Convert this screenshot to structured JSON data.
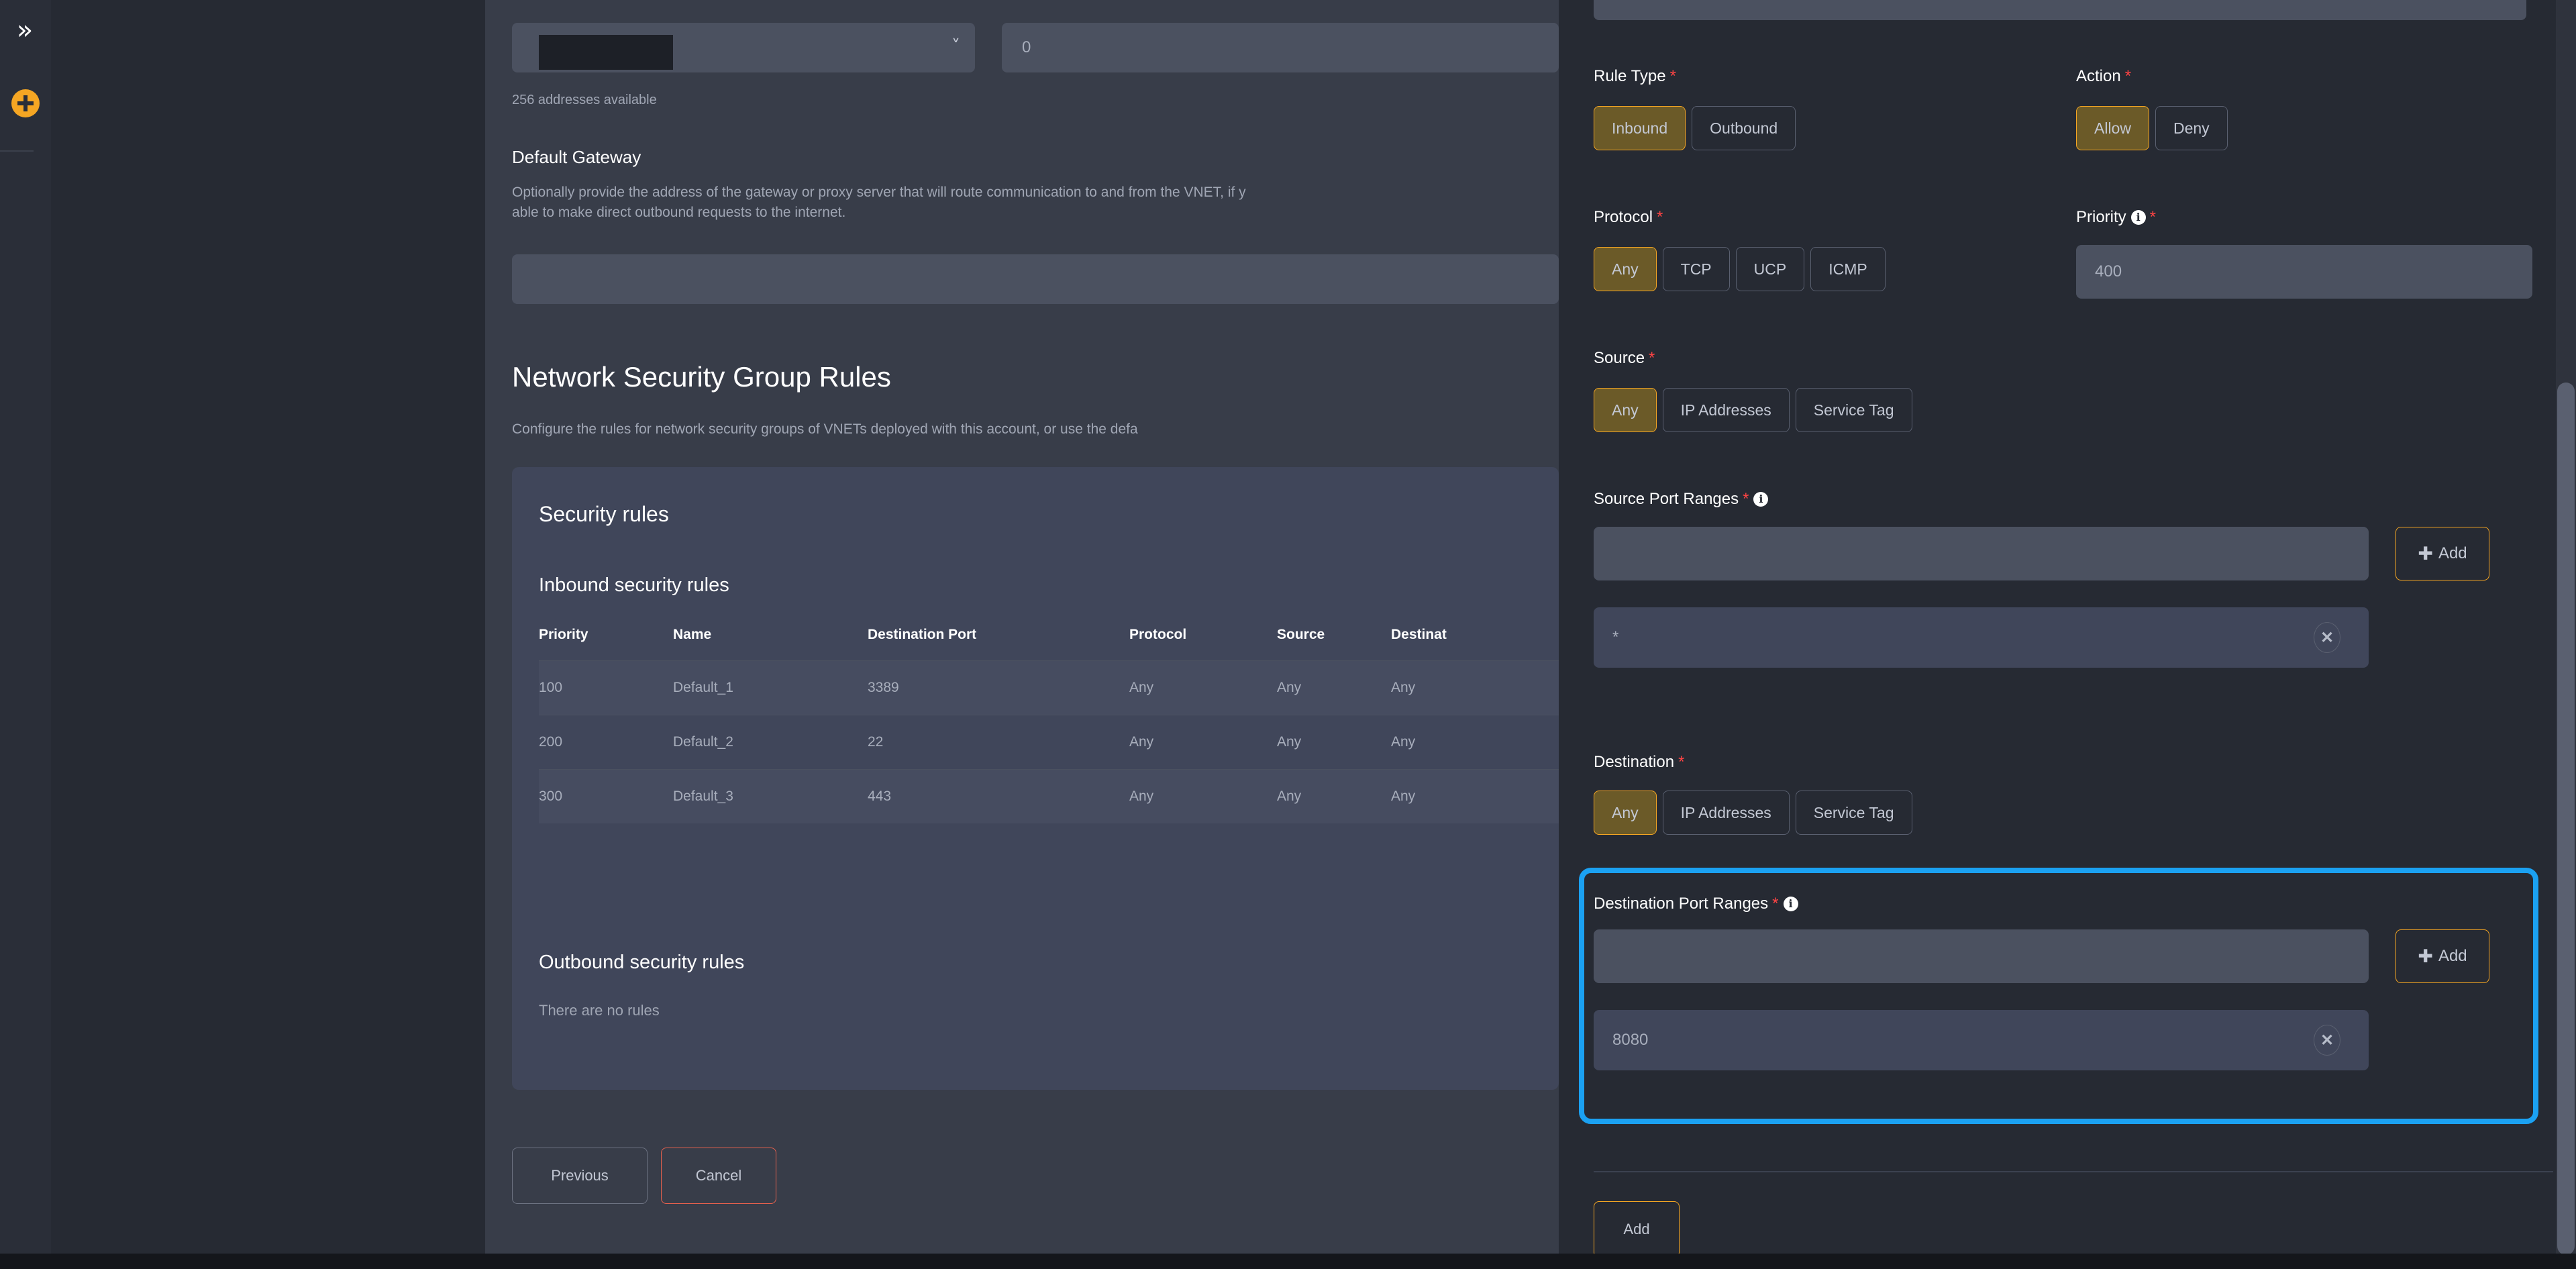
{
  "rail": {
    "collapse_icon": "double-chevron-right-icon",
    "add_icon": "plus-circle-icon"
  },
  "left_panel": {
    "address_space": {
      "helper": "256 addresses available",
      "dropdown_value": "",
      "caret": "▾"
    },
    "max_nodes": {
      "value": "0"
    },
    "default_gateway": {
      "title": "Default Gateway",
      "description": "Optionally provide the address of the gateway or proxy server that will route communication to and from the VNET, if y",
      "description_line2": "able to make direct outbound requests to the internet.",
      "value": ""
    },
    "nsg": {
      "title": "Network Security Group Rules",
      "description": "Configure the rules for network security groups of VNETs deployed with this account, or use the defa"
    },
    "security_rules_card": {
      "title": "Security rules",
      "inbound_title": "Inbound security rules",
      "columns": [
        "Priority",
        "Name",
        "Destination Port",
        "Protocol",
        "Source",
        "Destinat"
      ],
      "rows": [
        {
          "priority": "100",
          "name": "Default_1",
          "destination_port": "3389",
          "protocol": "Any",
          "source": "Any",
          "destination": "Any"
        },
        {
          "priority": "200",
          "name": "Default_2",
          "destination_port": "22",
          "protocol": "Any",
          "source": "Any",
          "destination": "Any"
        },
        {
          "priority": "300",
          "name": "Default_3",
          "destination_port": "443",
          "protocol": "Any",
          "source": "Any",
          "destination": "Any"
        }
      ],
      "outbound_title": "Outbound security rules",
      "outbound_empty": "There are no rules"
    },
    "footer": {
      "previous_label": "Previous",
      "cancel_label": "Cancel"
    }
  },
  "right_panel": {
    "rule_type": {
      "label": "Rule Type",
      "required": "*",
      "options": [
        "Inbound",
        "Outbound"
      ],
      "selected": "Inbound"
    },
    "action": {
      "label": "Action",
      "required": "*",
      "options": [
        "Allow",
        "Deny"
      ],
      "selected": "Allow"
    },
    "protocol": {
      "label": "Protocol",
      "required": "*",
      "options": [
        "Any",
        "TCP",
        "UCP",
        "ICMP"
      ],
      "selected": "Any"
    },
    "priority": {
      "label": "Priority",
      "required": "*",
      "info_icon": "info-icon",
      "value": "400"
    },
    "source": {
      "label": "Source",
      "required": "*",
      "options": [
        "Any",
        "IP Addresses",
        "Service Tag"
      ],
      "selected": "Any"
    },
    "source_port_ranges": {
      "label": "Source Port Ranges",
      "required": "*",
      "info_icon": "info-icon",
      "input_value": "",
      "add_label": "Add",
      "add_icon": "plus-icon",
      "chips": [
        {
          "value": "*",
          "remove_icon": "close-icon"
        }
      ]
    },
    "destination": {
      "label": "Destination",
      "required": "*",
      "options": [
        "Any",
        "IP Addresses",
        "Service Tag"
      ],
      "selected": "Any"
    },
    "destination_port_ranges": {
      "label": "Destination Port Ranges",
      "required": "*",
      "info_icon": "info-icon",
      "input_value": "",
      "add_label": "Add",
      "add_icon": "plus-icon",
      "chips": [
        {
          "value": "8080",
          "remove_icon": "close-icon"
        }
      ],
      "highlighted": true,
      "highlight_color": "#1ba1f2"
    },
    "submit": {
      "label": "Add"
    }
  },
  "colors": {
    "accent_amber": "#f5a623",
    "selected_fill": "#6b5a28",
    "danger": "#e8614d",
    "highlight": "#1ba1f2",
    "panel_bg": "#383d49",
    "drawer_bg": "#262a33",
    "card_bg": "#40465a"
  }
}
